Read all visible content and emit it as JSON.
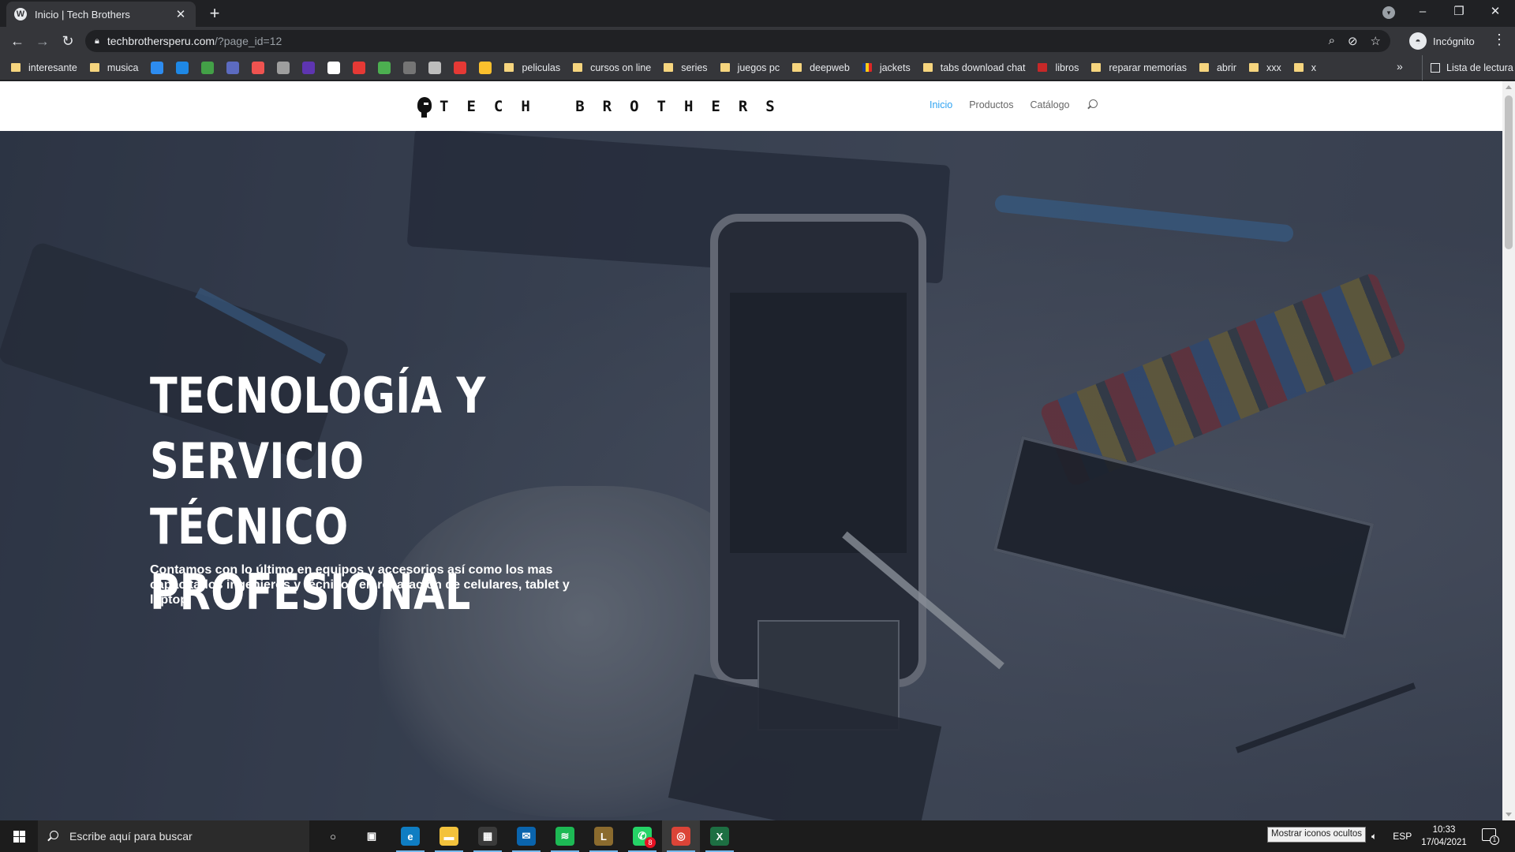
{
  "browser": {
    "tab": {
      "title": "Inicio | Tech Brothers",
      "close": "✕"
    },
    "new_tab": "+",
    "window_controls": {
      "minimize": "–",
      "restore": "❐",
      "close": "✕"
    },
    "toolbar": {
      "back": "←",
      "forward": "→",
      "reload": "↻"
    },
    "address": {
      "host": "techbrothersperu.com",
      "path": "/?page_id=12"
    },
    "omnibox_icons": {
      "zoom": "⌕",
      "eye_off": "⊘",
      "star": "☆"
    },
    "profile": {
      "label": "Incógnito",
      "icon": "incognito-icon"
    },
    "menu": "⋮",
    "bookmarks": [
      {
        "type": "folder",
        "label": "interesante"
      },
      {
        "type": "folder",
        "label": "musica"
      },
      {
        "type": "icon",
        "color": "#2d8cf0"
      },
      {
        "type": "icon",
        "color": "#1e88e5"
      },
      {
        "type": "icon",
        "color": "#43a047"
      },
      {
        "type": "icon",
        "color": "#5c6bc0"
      },
      {
        "type": "icon",
        "color": "#ef5350"
      },
      {
        "type": "icon",
        "color": "#9e9e9e"
      },
      {
        "type": "icon",
        "color": "#5e35b1"
      },
      {
        "type": "icon",
        "color": "#ffffff"
      },
      {
        "type": "icon",
        "color": "#e53935"
      },
      {
        "type": "icon",
        "color": "#4caf50"
      },
      {
        "type": "icon",
        "color": "#757575"
      },
      {
        "type": "icon",
        "color": "#bdbdbd"
      },
      {
        "type": "icon",
        "color": "#e53935"
      },
      {
        "type": "icon",
        "color": "#fbc02d"
      },
      {
        "type": "folder",
        "label": "peliculas"
      },
      {
        "type": "folder",
        "label": "cursos on line"
      },
      {
        "type": "folder",
        "label": "series"
      },
      {
        "type": "folder",
        "label": "juegos pc"
      },
      {
        "type": "folder",
        "label": "deepweb"
      },
      {
        "type": "flag",
        "label": "jackets"
      },
      {
        "type": "folder",
        "label": "tabs download chat"
      },
      {
        "type": "red",
        "label": "libros"
      },
      {
        "type": "folder",
        "label": "reparar memorias"
      },
      {
        "type": "folder",
        "label": "abrir"
      },
      {
        "type": "folder",
        "label": "xxx"
      },
      {
        "type": "folder",
        "label": "x"
      }
    ],
    "bookmarks_more": "»",
    "reading_list": "Lista de lectura"
  },
  "site": {
    "logo": "TECH BROTHERS",
    "nav": [
      {
        "label": "Inicio",
        "active": true
      },
      {
        "label": "Productos",
        "active": false
      },
      {
        "label": "Catálogo",
        "active": false
      }
    ],
    "hero": {
      "title_lines": [
        "TECNOLOGÍA Y",
        "SERVICIO TÉCNICO",
        "PROFESIONAL"
      ],
      "description": "Contamos con lo último en equipos y accesorios así como los mas capacitados ingenieros y técnicos en reparación de celulares, tablet y laptop."
    }
  },
  "taskbar": {
    "search_placeholder": "Escribe aquí para buscar",
    "apps": [
      {
        "name": "cortana",
        "glyph": "○",
        "color": "transparent"
      },
      {
        "name": "task-view",
        "glyph": "▣",
        "color": "transparent"
      },
      {
        "name": "edge",
        "glyph": "e",
        "color": "#0f7dc2"
      },
      {
        "name": "file-explorer",
        "glyph": "▬",
        "color": "#f3c23c"
      },
      {
        "name": "store",
        "glyph": "▦",
        "color": "#3a3a3a"
      },
      {
        "name": "mail",
        "glyph": "✉",
        "color": "#0a64ad"
      },
      {
        "name": "spotify",
        "glyph": "≋",
        "color": "#1db954"
      },
      {
        "name": "league",
        "glyph": "L",
        "color": "#8b6b2e"
      },
      {
        "name": "whatsapp",
        "glyph": "✆",
        "color": "#25d366",
        "badge": "8"
      },
      {
        "name": "chrome",
        "glyph": "◎",
        "color": "#db4437"
      },
      {
        "name": "excel",
        "glyph": "X",
        "color": "#1d6f42"
      }
    ],
    "tooltip": "Mostrar iconos ocultos",
    "language": "ESP",
    "time": "10:33",
    "date": "17/04/2021",
    "notifications": "1"
  }
}
